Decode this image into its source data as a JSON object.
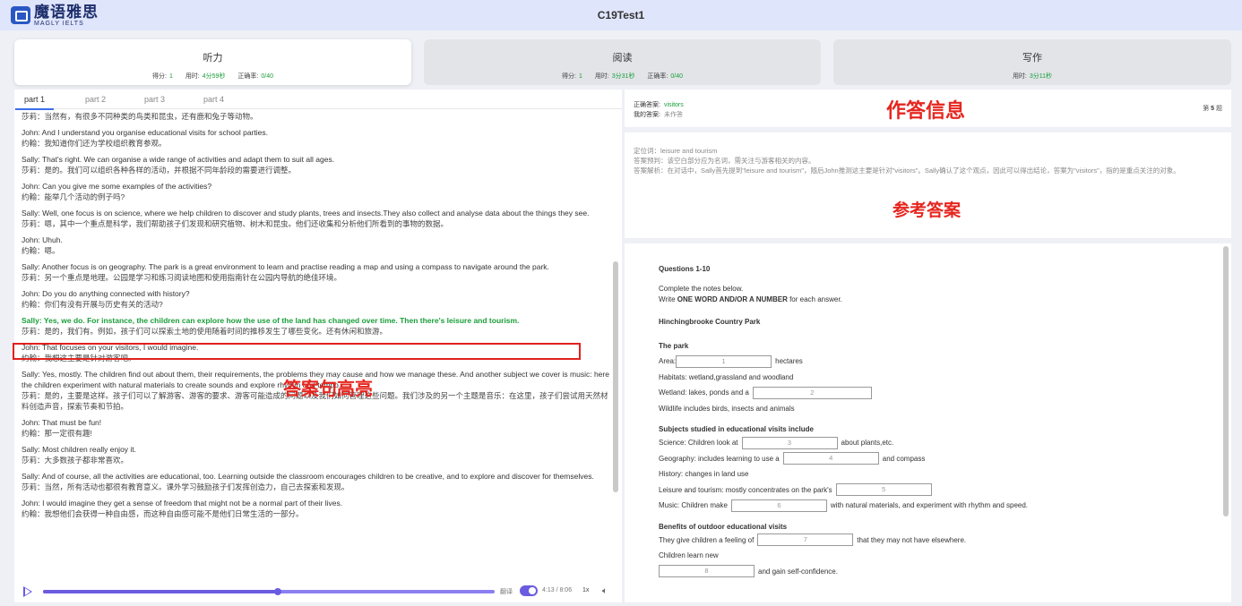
{
  "header": {
    "logo_cn": "魔语雅思",
    "logo_en": "MAGLY IELTS",
    "title": "C19Test1"
  },
  "sections": [
    {
      "name": "听力",
      "score_label": "得分:",
      "score": "1",
      "time_label": "用时:",
      "time": "4分59秒",
      "acc_label": "正确率:",
      "acc": "0/40"
    },
    {
      "name": "阅读",
      "score_label": "得分:",
      "score": "1",
      "time_label": "用时:",
      "time": "3分31秒",
      "acc_label": "正确率:",
      "acc": "0/40"
    },
    {
      "name": "写作",
      "time_label": "用时:",
      "time": "3分11秒"
    }
  ],
  "tabs": [
    "part 1",
    "part 2",
    "part 3",
    "part 4"
  ],
  "transcript": [
    {
      "en": "",
      "cn": "莎莉：当然有，有很多不同种类的鸟类和昆虫，还有鹿和兔子等动物。"
    },
    {
      "en": "John: And I understand you organise educational visits for school parties.",
      "cn": "约翰：我知道你们还为学校组织教育参观。"
    },
    {
      "en": "Sally: That's right. We can organise a wide range of activities and adapt them to suit all ages.",
      "cn": "莎莉：是的。我们可以组织各种各样的活动，并根据不同年龄段的需要进行调整。"
    },
    {
      "en": "John: Can you give me some examples of the activities?",
      "cn": "约翰：能举几个活动的例子吗?"
    },
    {
      "en": "Sally: Well, one focus is on science, where we help children to discover and study plants, trees and insects.They also collect and analyse data about the things they see.",
      "cn": "莎莉：嗯，其中一个重点是科学，我们帮助孩子们发现和研究植物、树木和昆虫。他们还收集和分析他们所看到的事物的数据。"
    },
    {
      "en": "John: Uhuh.",
      "cn": "约翰：嗯。"
    },
    {
      "en": "Sally: Another focus is on geography. The park is a great environment to learn and practise reading a map and using a compass to navigate around the park.",
      "cn": "莎莉：另一个重点是地理。公园是学习和练习阅读地图和使用指南针在公园内导航的绝佳环境。"
    },
    {
      "en": "John: Do you do anything connected with history?",
      "cn": "约翰：你们有没有开展与历史有关的活动?"
    },
    {
      "en": "Sally: Yes, we do. For instance, the children can explore how the use of the land has changed over time. Then there's leisure and tourism.",
      "cn": "莎莉：是的，我们有。例如，孩子们可以探索土地的使用随着时间的推移发生了哪些变化。还有休闲和旅游。",
      "highlight": true
    },
    {
      "en": "John: That focuses on your visitors, I would imagine.",
      "cn": "约翰：我想这主要是针对游客吧。"
    },
    {
      "en": "Sally: Yes, mostly. The children find out about them, their requirements, the problems they may cause and how we manage these. And another subject we cover is music: here the children experiment with natural materials to create sounds and explore rhythm and tempo.",
      "cn": "莎莉：是的，主要是这样。孩子们可以了解游客、游客的要求、游客可能造成的问题以及我们如何管理这些问题。我们涉及的另一个主题是音乐：在这里，孩子们尝试用天然材料创造声音，探索节奏和节拍。"
    },
    {
      "en": "John: That must be fun!",
      "cn": "约翰：那一定很有趣!"
    },
    {
      "en": "Sally: Most children really enjoy it.",
      "cn": "莎莉：大多数孩子都非常喜欢。"
    },
    {
      "en": "Sally: And of course, all the activities are educational, too. Learning outside the classroom encourages children to be creative, and to explore and discover for themselves.",
      "cn": "莎莉：当然，所有活动也都很有教育意义。课外学习鼓励孩子们发挥创造力，自己去探索和发现。"
    },
    {
      "en": "John: I would imagine they get a sense of freedom that might not be a normal part of their lives.",
      "cn": "约翰：我想他们会获得一种自由感，而这种自由感可能不是他们日常生活的一部分。"
    }
  ],
  "annotations": {
    "highlight_label": "答案句高亮",
    "answer_info_label": "作答信息",
    "reference_label": "参考答案"
  },
  "audio": {
    "progress": 0.52,
    "translate_label": "翻译",
    "time": "4:13 / 8:06",
    "speed": "1x"
  },
  "answer": {
    "correct_label": "正确答案:",
    "correct_value": "visitors",
    "mine_label": "我的答案:",
    "mine_value": "未作答",
    "qnum_prefix": "第",
    "qnum": "5",
    "qnum_suffix": "题"
  },
  "reference": {
    "line1": "定位词：leisure and tourism",
    "line2": "答案预判：该空白部分应为名词，需关注与游客相关的内容。",
    "line3": "答案解析：在对话中，Sally首先提到\"leisure and tourism\"，随后John推测这主要是针对\"visitors\"。Sally确认了这个观点，因此可以得出结论，答案为\"visitors\"，指的是重点关注的对象。"
  },
  "questions": {
    "head": "Questions 1-10",
    "instr1": "Complete the notes below.",
    "instr2_pre": "Write ",
    "instr2_bold": "ONE WORD AND/OR A NUMBER",
    "instr2_post": " for each answer.",
    "title": "Hinchingbrooke Country Park",
    "park_head": "The park",
    "area_pre": "Area:",
    "blank1": "1",
    "area_post": "hectares",
    "habitats": "Habitats: wetland,grassland and woodland",
    "wetland_pre": "Wetland: lakes, ponds and a",
    "blank2": "2",
    "wildlife": "Wildlife includes birds, insects and animals",
    "subjects_head": "Subjects studied in educational visits include",
    "science_pre": "Science: Children look at",
    "blank3": "3",
    "science_post": "about plants,etc.",
    "geo_pre": "Geography: includes learning to use a",
    "blank4": "4",
    "geo_post": "and compass",
    "history": "History: changes in land use",
    "leisure_pre": "Leisure and tourism: mostly concentrates on the park's",
    "blank5": "5",
    "music_pre": "Music: Children make",
    "blank6": "6",
    "music_post": "with natural materials, and experiment with rhythm and speed.",
    "benefits_head": "Benefits of outdoor educational visits",
    "feeling_pre": "They give children a feeling of",
    "blank7": "7",
    "feeling_post": "that they may not have elsewhere.",
    "learn": "Children learn new",
    "blank8": "8",
    "learn_post": "and gain self-confidence."
  }
}
